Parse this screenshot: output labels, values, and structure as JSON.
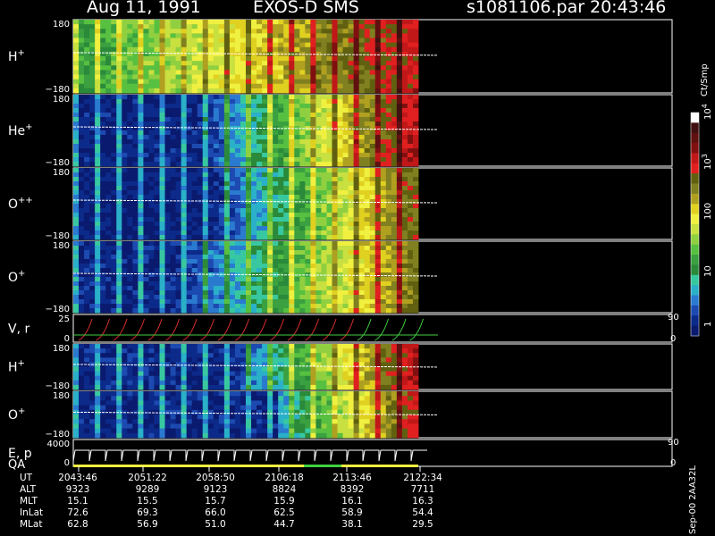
{
  "header": {
    "date": "Aug 11, 1991",
    "instrument": "EXOS-D SMS",
    "file": "s1081106.par",
    "time": "20:43:46"
  },
  "chart_data": {
    "type": "heatmap",
    "time_ticks": [
      "2043:46",
      "2051:22",
      "2058:50",
      "2106:18",
      "2113:46",
      "2122:34"
    ],
    "panels": [
      {
        "label": "H",
        "charge": "+",
        "ymax": "180",
        "ymin": "−180"
      },
      {
        "label": "He",
        "charge": "+",
        "ymax": "180",
        "ymin": "−180"
      },
      {
        "label": "O",
        "charge": "++",
        "ymax": "180",
        "ymin": "−180"
      },
      {
        "label": "O",
        "charge": "+",
        "ymax": "180",
        "ymin": "−180"
      },
      {
        "label": "V, r",
        "ymax": "25",
        "ymin": "0",
        "right_top": "90",
        "right_bottom": "0"
      },
      {
        "label": "H",
        "charge": "+",
        "ymax": "180",
        "ymin": "−180"
      },
      {
        "label": "O",
        "charge": "+",
        "ymax": "180",
        "ymin": "−180"
      },
      {
        "label": "E, p",
        "label2": "QA",
        "ymax": "4000",
        "ymin": "0",
        "right_top": "90",
        "right_bottom": "0"
      }
    ],
    "colorbar": {
      "unit": "Ct/Smp",
      "tick_labels": [
        "1",
        "10",
        "100",
        "10",
        "10"
      ],
      "tick_exponents": [
        "",
        "",
        "",
        "3",
        "4"
      ],
      "colors": [
        "#0a1a6e",
        "#0c2a8a",
        "#1c4ab0",
        "#2a7ad0",
        "#2ab0c8",
        "#38c8a0",
        "#2a8a3a",
        "#3aa040",
        "#58c040",
        "#90d040",
        "#c8e040",
        "#f0f040",
        "#e0d020",
        "#b0a020",
        "#808020",
        "#606010",
        "#e02020",
        "#c01818",
        "#801010",
        "#601010",
        "#401010",
        "#ffffff"
      ]
    }
  },
  "footer": {
    "rows": [
      {
        "label": "UT",
        "values": [
          "2043:46",
          "2051:22",
          "2058:50",
          "2106:18",
          "2113:46",
          "2122:34"
        ]
      },
      {
        "label": "ALT",
        "values": [
          "9323",
          "9289",
          "9123",
          "8824",
          "8392",
          "7711"
        ]
      },
      {
        "label": "MLT",
        "values": [
          "15.1",
          "15.5",
          "15.7",
          "15.9",
          "16.1",
          "16.3"
        ]
      },
      {
        "label": "InLat",
        "values": [
          "72.6",
          "69.3",
          "66.0",
          "62.5",
          "58.9",
          "54.4"
        ]
      },
      {
        "label": "MLat",
        "values": [
          "62.8",
          "56.9",
          "51.0",
          "44.7",
          "38.1",
          "29.5"
        ]
      }
    ],
    "stamp": "Sep-00 2AA32L"
  }
}
